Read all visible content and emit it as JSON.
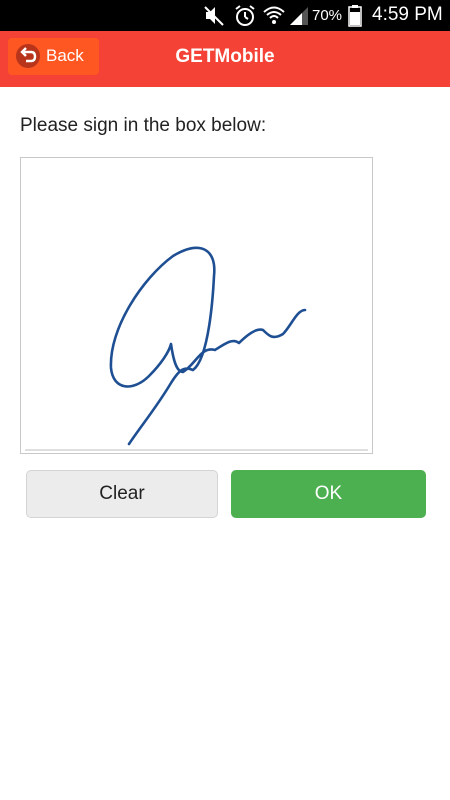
{
  "status_bar": {
    "battery_percent": "70%",
    "time": "4:59 PM",
    "icons": [
      "mute-icon",
      "alarm-icon",
      "wifi-icon",
      "signal-icon",
      "battery-icon"
    ]
  },
  "header": {
    "back_label": "Back",
    "title": "GETMobile"
  },
  "signature": {
    "instruction": "Please sign in the box below:",
    "ink_color": "#1f4f93"
  },
  "buttons": {
    "clear_label": "Clear",
    "ok_label": "OK"
  },
  "colors": {
    "header_bg": "#f44336",
    "back_button_bg": "#ff5722",
    "ok_button_bg": "#4caf50",
    "clear_button_bg": "#ececec"
  }
}
